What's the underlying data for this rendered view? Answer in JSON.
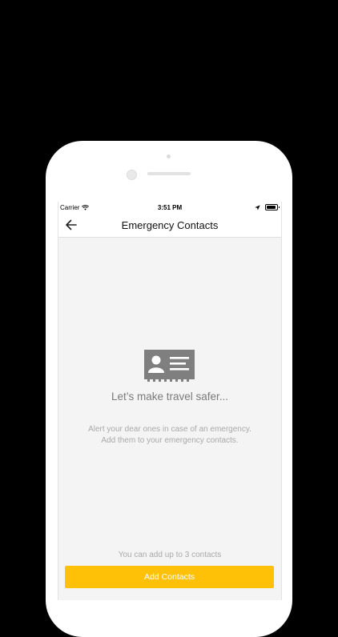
{
  "status_bar": {
    "carrier": "Carrier",
    "time": "3:51 PM",
    "icons": [
      "wifi-icon",
      "location-arrow-icon",
      "battery-icon"
    ]
  },
  "header": {
    "back_icon": "arrow-left-icon",
    "title": "Emergency Contacts"
  },
  "empty_state": {
    "illustration_icon": "contact-card-icon",
    "title": "Let’s make travel safer...",
    "description_line1": "Alert your dear ones in case of an emergency.",
    "description_line2": "Add them to your emergency contacts."
  },
  "footer": {
    "limit_note": "You can add up to 3 contacts",
    "add_button_label": "Add Contacts"
  },
  "colors": {
    "accent": "#ffc107",
    "screen_background": "#f4f4f4",
    "illustration": "#7f7f7f"
  }
}
